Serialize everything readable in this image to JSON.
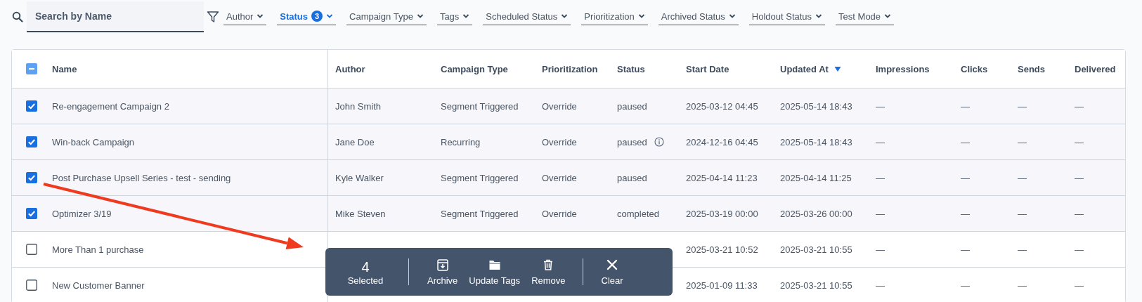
{
  "search": {
    "placeholder": "Search by Name"
  },
  "filters": [
    {
      "label": "Author",
      "active": false
    },
    {
      "label": "Status",
      "active": true,
      "count": "3"
    },
    {
      "label": "Campaign Type",
      "active": false
    },
    {
      "label": "Tags",
      "active": false
    },
    {
      "label": "Scheduled Status",
      "active": false
    },
    {
      "label": "Prioritization",
      "active": false
    },
    {
      "label": "Archived Status",
      "active": false
    },
    {
      "label": "Holdout Status",
      "active": false
    },
    {
      "label": "Test Mode",
      "active": false
    }
  ],
  "table": {
    "select_all": {
      "partial": true
    },
    "columns": [
      {
        "label": "Name"
      },
      {
        "label": "Author"
      },
      {
        "label": "Campaign Type"
      },
      {
        "label": "Prioritization"
      },
      {
        "label": "Status"
      },
      {
        "label": "Start Date"
      },
      {
        "label": "Updated At",
        "sorted_descending": true
      },
      {
        "label": "Impressions"
      },
      {
        "label": "Clicks"
      },
      {
        "label": "Sends"
      },
      {
        "label": "Delivered"
      }
    ],
    "rows": [
      {
        "selected": true,
        "name": "Re-engagement Campaign 2",
        "author": "John Smith",
        "campaign_type": "Segment Triggered",
        "prioritization": "Override",
        "status": "paused",
        "start_date": "2025-03-12 04:45",
        "updated_at": "2025-05-14 18:43",
        "impressions": "—",
        "clicks": "—",
        "sends": "—",
        "delivered": "—"
      },
      {
        "selected": true,
        "name": "Win-back Campaign",
        "author": "Jane Doe",
        "campaign_type": "Recurring",
        "prioritization": "Override",
        "status": "paused",
        "status_info": true,
        "start_date": "2024-12-16 04:45",
        "updated_at": "2025-05-14 18:43",
        "impressions": "—",
        "clicks": "—",
        "sends": "—",
        "delivered": "—"
      },
      {
        "selected": true,
        "name": "Post Purchase Upsell Series - test - sending",
        "author": "Kyle Walker",
        "campaign_type": "Segment Triggered",
        "prioritization": "Override",
        "status": "paused",
        "start_date": "2025-04-14 11:23",
        "updated_at": "2025-04-14 11:25",
        "impressions": "—",
        "clicks": "—",
        "sends": "—",
        "delivered": "—"
      },
      {
        "selected": true,
        "name": "Optimizer 3/19",
        "author": "Mike Steven",
        "campaign_type": "Segment Triggered",
        "prioritization": "Override",
        "status": "completed",
        "start_date": "2025-03-19 00:00",
        "updated_at": "2025-03-26 00:00",
        "impressions": "—",
        "clicks": "—",
        "sends": "—",
        "delivered": "—"
      },
      {
        "selected": false,
        "name": "More Than 1 purchase",
        "start_date": "2025-03-21 10:52",
        "updated_at": "2025-03-21 10:55",
        "impressions": "—",
        "clicks": "—",
        "sends": "—",
        "delivered": "—"
      },
      {
        "selected": false,
        "name": "New Customer Banner",
        "start_date": "2025-01-09 11:33",
        "updated_at": "2025-03-21 10:55",
        "impressions": "—",
        "clicks": "—",
        "sends": "—",
        "delivered": "—"
      }
    ]
  },
  "bulk_bar": {
    "count": "4",
    "count_label": "Selected",
    "actions": [
      {
        "kind": "archive",
        "label": "Archive"
      },
      {
        "kind": "folder",
        "label": "Update Tags"
      },
      {
        "kind": "trash",
        "label": "Remove"
      },
      {
        "kind": "close",
        "label": "Clear"
      }
    ]
  }
}
